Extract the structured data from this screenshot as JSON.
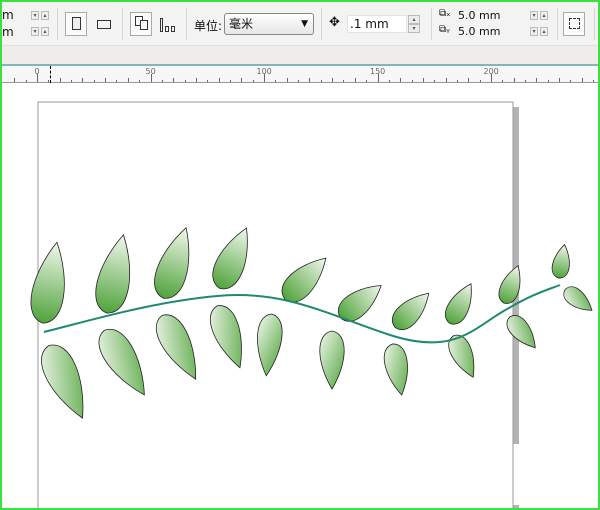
{
  "toolbar": {
    "width_unit_fragment": "m",
    "height_unit_fragment": "m",
    "units_label": "单位:",
    "units_value": "毫米",
    "nudge_value": ".1 mm",
    "duplicate_x": "5.0 mm",
    "duplicate_y": "5.0 mm",
    "icons": [
      "portrait-icon",
      "landscape-icon",
      "all-pages-icon",
      "current-page-icon",
      "nudge-icon",
      "duplicate-x-icon",
      "duplicate-y-icon",
      "treat-as-filled-icon"
    ]
  },
  "ruler": {
    "labels": [
      "0",
      "50",
      "100",
      "150",
      "200"
    ]
  },
  "colors": {
    "frame": "#3ee03e",
    "leaf": "#5aaa40",
    "stem": "#1f8a70"
  }
}
